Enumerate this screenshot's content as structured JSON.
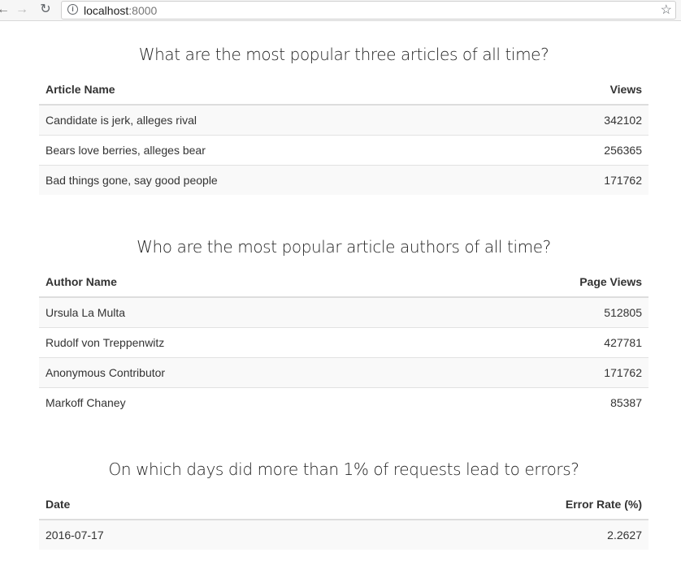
{
  "browser": {
    "url_host": "localhost",
    "url_port": ":8000"
  },
  "sections": [
    {
      "title": "What are the most popular three articles of all time?",
      "columns": [
        "Article Name",
        "Views"
      ],
      "rows": [
        [
          "Candidate is jerk, alleges rival",
          "342102"
        ],
        [
          "Bears love berries, alleges bear",
          "256365"
        ],
        [
          "Bad things gone, say good people",
          "171762"
        ]
      ]
    },
    {
      "title": "Who are the most popular article authors of all time?",
      "columns": [
        "Author Name",
        "Page Views"
      ],
      "rows": [
        [
          "Ursula La Multa",
          "512805"
        ],
        [
          "Rudolf von Treppenwitz",
          "427781"
        ],
        [
          "Anonymous Contributor",
          "171762"
        ],
        [
          "Markoff Chaney",
          "85387"
        ]
      ]
    },
    {
      "title": "On which days did more than 1% of requests lead to errors?",
      "columns": [
        "Date",
        "Error Rate (%)"
      ],
      "rows": [
        [
          "2016-07-17",
          "2.2627"
        ]
      ]
    }
  ]
}
